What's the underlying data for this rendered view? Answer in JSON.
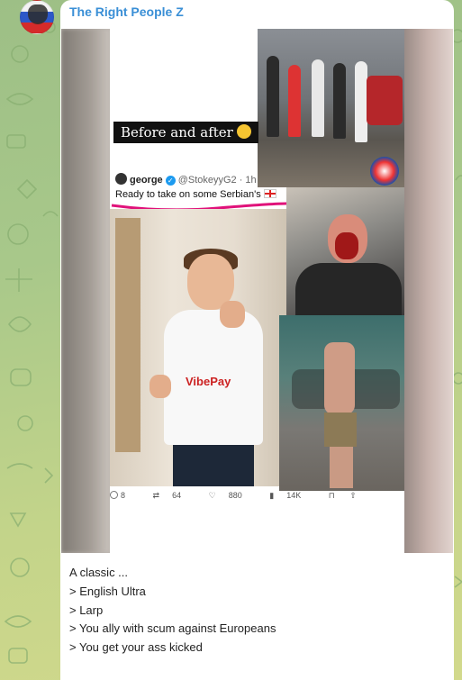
{
  "channel": {
    "name": "The Right People Z",
    "avatar_icon": "flag-eagle-avatar",
    "name_color": "#3a8fd6"
  },
  "media": {
    "overlay_text": "Before and after",
    "overlay_emoji": "rolling-laughing-emoji",
    "tweet": {
      "display_name": "george",
      "handle": "@StokeyyG2 · 1h",
      "text": "Ready to take on some Serbian's",
      "flag_icon": "england-flag-icon",
      "shirt_sponsor": "VibePay",
      "stats": {
        "replies": "8",
        "reposts": "64",
        "likes": "880",
        "views": "14K"
      }
    }
  },
  "caption": {
    "lines": [
      "A classic ...",
      "",
      "> English Ultra",
      "> Larp",
      "> You ally with scum against Europeans",
      "> You get your ass kicked"
    ]
  }
}
